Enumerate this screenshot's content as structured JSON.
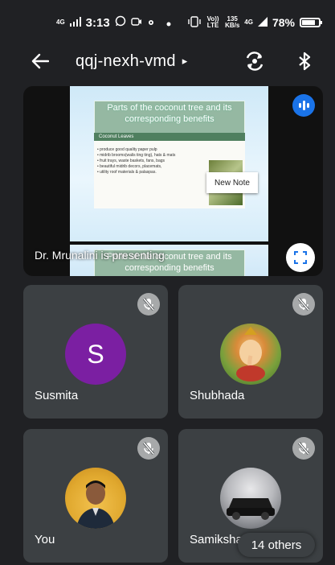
{
  "status_bar": {
    "network": "4G",
    "time": "3:13",
    "lte_label": "Vo)) LTE",
    "speed_value": "135",
    "speed_unit": "KB/s",
    "signal2": "4G",
    "battery": "78%",
    "battery_level": 0.78
  },
  "top_bar": {
    "meeting_code": "qqj-nexh-vmd",
    "caret": "▸"
  },
  "presentation": {
    "presenter_label": "Dr. Mrunalini is presenting",
    "slide_title": "Parts of the coconut tree and its corresponding benefits",
    "slide_subhead": "Coconut Leaves",
    "slide_bullets": [
      "produce good quality paper pulp",
      "midrib brooms(walis ting ting), hats & mats",
      "fruit trays, waste baskets, fans, bags",
      "beautiful midrib decors, placemats,",
      "utility roof materials & palaspas."
    ],
    "note_label": "New Note",
    "slide2_title": "Parts of the coconut tree and its corresponding benefits"
  },
  "participants": [
    {
      "name": "Susmita",
      "initial": "S",
      "avatar_color": "#7b1fa2",
      "muted": true
    },
    {
      "name": "Shubhada",
      "muted": true
    },
    {
      "name": "You",
      "muted": true
    },
    {
      "name": "Samiksha",
      "muted": true
    }
  ],
  "others_label": "14 others",
  "colors": {
    "background": "#202124",
    "tile": "#3c4043",
    "accent": "#1a73e8"
  }
}
